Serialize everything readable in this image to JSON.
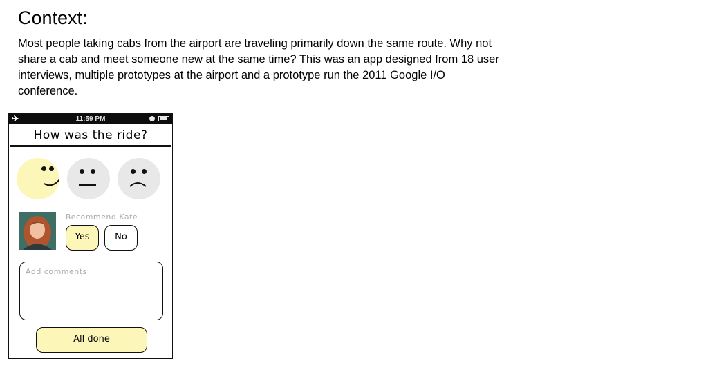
{
  "context": {
    "title": "Context:",
    "body": "Most people taking cabs from the airport are traveling primarily down the same route. Why not share a cab and meet someone new at the same time? This was an app designed from 18 user interviews, multiple prototypes at the airport and a prototype run the 2011 Google I/O conference."
  },
  "status_bar": {
    "time": "11:59 PM",
    "airplane_icon": "airplane-icon"
  },
  "screen": {
    "question": "How was the ride?",
    "ratings": [
      "happy",
      "neutral",
      "sad"
    ],
    "selected_rating": "happy",
    "recommend_label": "Recommend Kate",
    "yes_label": "Yes",
    "no_label": "No",
    "comments_placeholder": "Add comments",
    "done_label": "All done"
  },
  "colors": {
    "highlight": "#fdf6b9",
    "neutral_face": "#e8e8e8"
  }
}
